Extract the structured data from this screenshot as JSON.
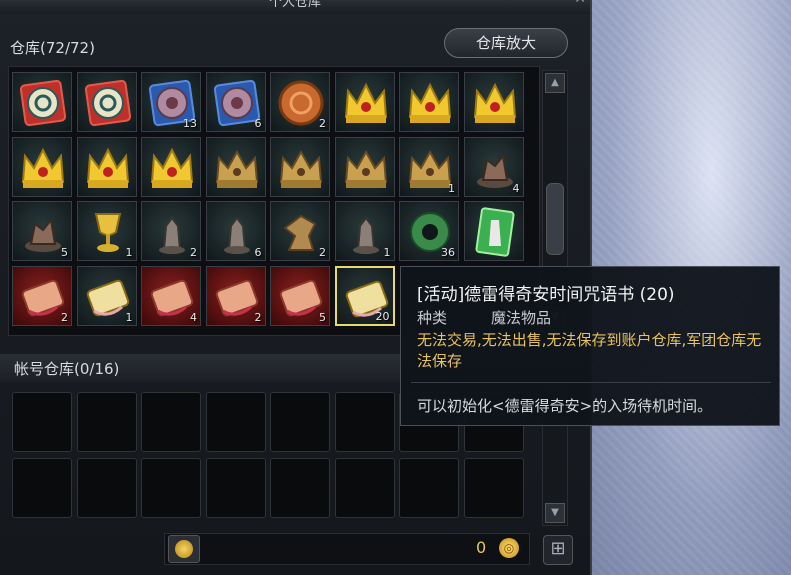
{
  "window": {
    "title": "个人仓库",
    "close_glyph": "✕"
  },
  "storage": {
    "label": "仓库(72/72)",
    "expand_button": "仓库放大",
    "slots": [
      {
        "icon": "blue-rune-tile-icon",
        "qty": ""
      },
      {
        "icon": "blue-rune-tile-icon",
        "qty": ""
      },
      {
        "icon": "purple-rune-tile-icon",
        "qty": "13"
      },
      {
        "icon": "purple-rune-tile-icon",
        "qty": "6"
      },
      {
        "icon": "copper-coin-icon",
        "qty": "2"
      },
      {
        "icon": "gold-crown-icon",
        "qty": ""
      },
      {
        "icon": "gold-crown-icon",
        "qty": ""
      },
      {
        "icon": "gold-crown-icon",
        "qty": ""
      },
      {
        "icon": "gold-crown-icon",
        "qty": ""
      },
      {
        "icon": "gold-crown-icon",
        "qty": ""
      },
      {
        "icon": "gold-crown-icon",
        "qty": ""
      },
      {
        "icon": "bronze-crown-icon",
        "qty": ""
      },
      {
        "icon": "bronze-crown-icon",
        "qty": ""
      },
      {
        "icon": "bronze-crown-icon",
        "qty": ""
      },
      {
        "icon": "bronze-crown-icon",
        "qty": "1"
      },
      {
        "icon": "relic-figure-icon",
        "qty": "4"
      },
      {
        "icon": "relic-figure-icon",
        "qty": "5"
      },
      {
        "icon": "golden-chalice-icon",
        "qty": "1"
      },
      {
        "icon": "stone-statue-icon",
        "qty": "2"
      },
      {
        "icon": "stone-statue-icon",
        "qty": "6"
      },
      {
        "icon": "bronze-eagle-icon",
        "qty": "2"
      },
      {
        "icon": "stone-statue-icon",
        "qty": "1"
      },
      {
        "icon": "jade-ring-icon",
        "qty": "36"
      },
      {
        "icon": "green-card-icon",
        "qty": ""
      },
      {
        "icon": "red-scroll-icon",
        "qty": "2"
      },
      {
        "icon": "gold-scroll-icon",
        "qty": "1"
      },
      {
        "icon": "red-scroll-icon",
        "qty": "4"
      },
      {
        "icon": "red-scroll-icon",
        "qty": "2"
      },
      {
        "icon": "red-scroll-icon",
        "qty": "5"
      },
      {
        "icon": "gold-scroll-icon",
        "qty": "20"
      }
    ]
  },
  "account_storage": {
    "label": "帐号仓库(0/16)"
  },
  "footer": {
    "money": "0"
  },
  "tooltip": {
    "title": "[活动]德雷得奇安时间咒语书 (20)",
    "type_key": "种类",
    "type_value": "魔法物品",
    "restrictions": "无法交易,无法出售,无法保存到账户仓库,军团仓库无法保存",
    "description": "可以初始化<德雷得奇安>的入场待机时间。"
  }
}
